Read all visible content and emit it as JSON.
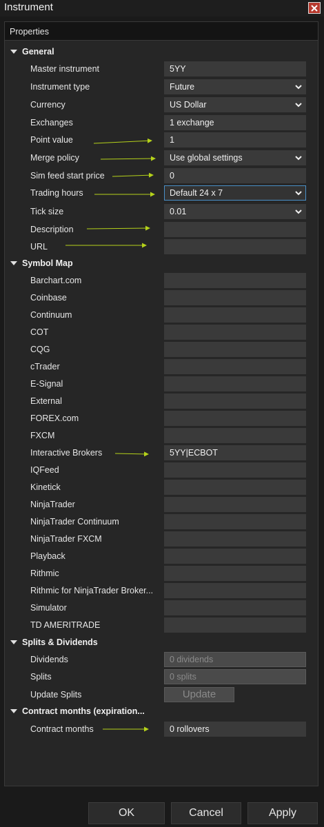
{
  "window": {
    "title": "Instrument"
  },
  "panel": {
    "title": "Properties"
  },
  "sections": {
    "general": "General",
    "symbol_map": "Symbol Map",
    "splits": "Splits & Dividends",
    "contract": "Contract months (expiration..."
  },
  "general": {
    "master_instrument": {
      "label": "Master instrument",
      "value": "5YY"
    },
    "instrument_type": {
      "label": "Instrument type",
      "value": "Future"
    },
    "currency": {
      "label": "Currency",
      "value": "US Dollar"
    },
    "exchanges": {
      "label": "Exchanges",
      "value": "1 exchange"
    },
    "point_value": {
      "label": "Point value",
      "value": "1"
    },
    "merge_policy": {
      "label": "Merge policy",
      "value": "Use global settings"
    },
    "sim_feed": {
      "label": "Sim feed start price",
      "value": "0"
    },
    "trading_hours": {
      "label": "Trading hours",
      "value": "Default 24 x 7"
    },
    "tick_size": {
      "label": "Tick size",
      "value": "0.01"
    },
    "description": {
      "label": "Description",
      "value": ""
    },
    "url": {
      "label": "URL",
      "value": ""
    }
  },
  "symbol_map": [
    {
      "label": "Barchart.com",
      "value": ""
    },
    {
      "label": "Coinbase",
      "value": ""
    },
    {
      "label": "Continuum",
      "value": ""
    },
    {
      "label": "COT",
      "value": ""
    },
    {
      "label": "CQG",
      "value": ""
    },
    {
      "label": "cTrader",
      "value": ""
    },
    {
      "label": "E-Signal",
      "value": ""
    },
    {
      "label": "External",
      "value": ""
    },
    {
      "label": "FOREX.com",
      "value": ""
    },
    {
      "label": "FXCM",
      "value": ""
    },
    {
      "label": "Interactive Brokers",
      "value": "5YY|ECBOT"
    },
    {
      "label": "IQFeed",
      "value": ""
    },
    {
      "label": "Kinetick",
      "value": ""
    },
    {
      "label": "NinjaTrader",
      "value": ""
    },
    {
      "label": "NinjaTrader Continuum",
      "value": ""
    },
    {
      "label": "NinjaTrader FXCM",
      "value": ""
    },
    {
      "label": "Playback",
      "value": ""
    },
    {
      "label": "Rithmic",
      "value": ""
    },
    {
      "label": "Rithmic for NinjaTrader Broker...",
      "value": ""
    },
    {
      "label": "Simulator",
      "value": ""
    },
    {
      "label": "TD AMERITRADE",
      "value": ""
    }
  ],
  "splits": {
    "dividends": {
      "label": "Dividends",
      "value": "0 dividends"
    },
    "splits": {
      "label": "Splits",
      "value": "0 splits"
    },
    "update": {
      "label": "Update Splits",
      "button": "Update"
    }
  },
  "contract": {
    "months": {
      "label": "Contract months",
      "value": "0 rollovers"
    }
  },
  "buttons": {
    "ok": "OK",
    "cancel": "Cancel",
    "apply": "Apply"
  },
  "colors": {
    "annotation_arrow": "#b5d21a",
    "close_button": "#b83a2e",
    "selected_border": "#4a90c8"
  }
}
